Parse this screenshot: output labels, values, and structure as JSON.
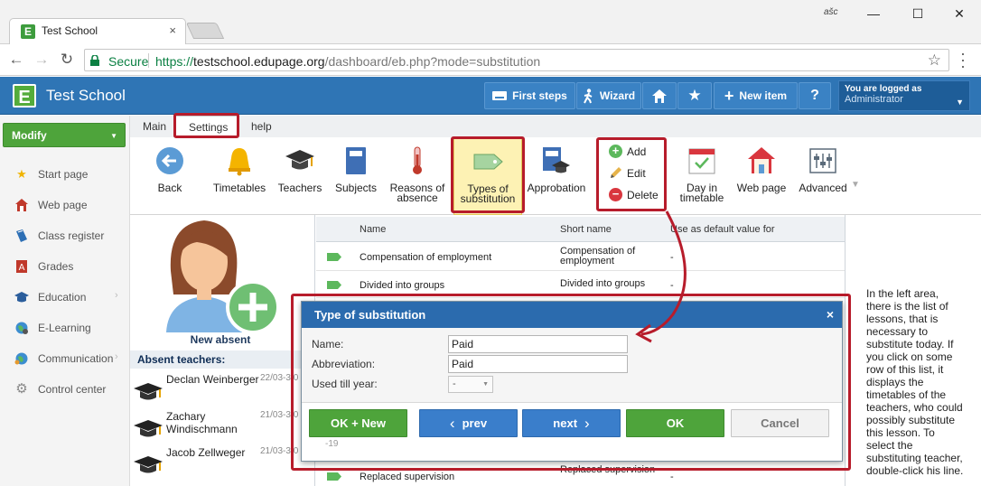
{
  "browser": {
    "tab_title": "Test School",
    "tab_close": "×",
    "user_badge": "ašc",
    "window_buttons": [
      "—",
      "☐",
      "✕"
    ],
    "secure_label": "Secure",
    "url_scheme": "https://",
    "url_host": "testschool.edupage.org",
    "url_path": "/dashboard/eb.php?mode=substitution"
  },
  "header": {
    "app_name": "Test School",
    "buttons": {
      "first_steps": "First steps",
      "wizard": "Wizard",
      "new_item": "New item",
      "help": "?"
    },
    "logged_label": "You are logged as",
    "logged_user": "Administrator",
    "colors": {
      "header_bg": "#2f75b5",
      "accent_green": "#4ea43b",
      "annotation_red": "#b71c2b"
    }
  },
  "sidebar": {
    "modify_label": "Modify",
    "items": [
      {
        "label": "Start page",
        "icon": "star-icon"
      },
      {
        "label": "Web page",
        "icon": "house-icon"
      },
      {
        "label": "Class register",
        "icon": "book-icon"
      },
      {
        "label": "Grades",
        "icon": "grade-icon"
      },
      {
        "label": "Education",
        "icon": "graduation-icon",
        "chevron": "›"
      },
      {
        "label": "E-Learning",
        "icon": "globe-icon"
      },
      {
        "label": "Communication",
        "icon": "globe-people-icon",
        "chevron": "›"
      },
      {
        "label": "Control center",
        "icon": "gear-icon"
      }
    ]
  },
  "menu_tabs": {
    "main": "Main",
    "settings": "Settings",
    "help": "help"
  },
  "ribbon": {
    "back": "Back",
    "timetables": "Timetables",
    "teachers": "Teachers",
    "subjects": "Subjects",
    "reasons_of_absence": "Reasons of\nabsence",
    "types_of_substitution": "Types of\nsubstitution",
    "approbation": "Approbation",
    "add": "Add",
    "edit": "Edit",
    "delete": "Delete",
    "day_in_timetable": "Day in\ntimetable",
    "web_page": "Web page",
    "advanced": "Advanced"
  },
  "absent_panel": {
    "new_absent_label": "New absent",
    "header": "Absent teachers:",
    "teachers": [
      {
        "name": "Declan Weinberger",
        "date": "22/03-3/0"
      },
      {
        "name": "Zachary Windischmann",
        "date": "21/03-3/0"
      },
      {
        "name": "Jacob Zellweger",
        "date": "21/03-3/0"
      }
    ]
  },
  "table": {
    "headers": [
      "Name",
      "Short name",
      "Use as default value for"
    ],
    "rows": [
      {
        "name": "Compensation of employment",
        "short": "Compensation of employment",
        "default": "-"
      },
      {
        "name": "Divided into groups",
        "short": "Divided into groups",
        "default": "-"
      },
      {
        "name": "Replaced supervision",
        "short": "Replaced supervision",
        "default": "-"
      }
    ]
  },
  "help_text": "In the left area, there is the list of lessons, that is necessary to substitute today. If you click on some row of this list, it displays the timetables of the teachers, who could possibly substitute this lesson. To select the substituting teacher, double-click his line.",
  "modal": {
    "title": "Type of substitution",
    "close": "×",
    "name_label": "Name:",
    "name_value": "Paid",
    "abbreviation_label": "Abbreviation:",
    "abbreviation_value": "Paid",
    "used_till_label": "Used till year:",
    "used_till_value": "-",
    "hidden_number": "-19",
    "buttons": {
      "ok_new": "OK + New",
      "prev": "prev",
      "next": "next",
      "ok": "OK",
      "cancel": "Cancel"
    }
  }
}
